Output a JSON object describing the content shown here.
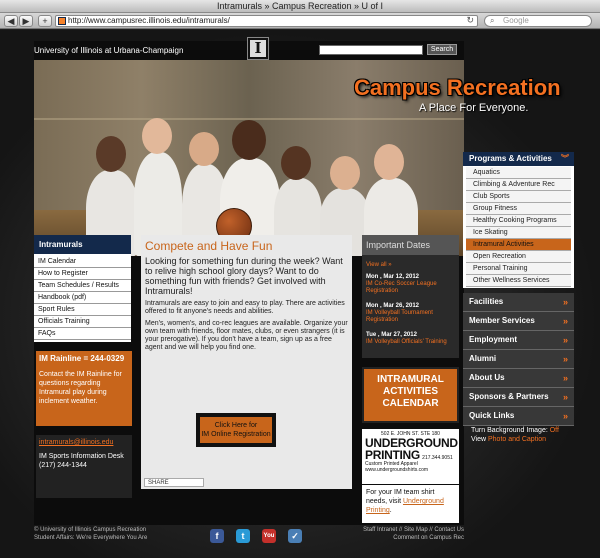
{
  "window": {
    "title": "Intramurals » Campus Recreation » U of I"
  },
  "toolbar": {
    "back": "◀",
    "forward": "▶",
    "add": "+",
    "url": "http://www.campusrec.illinois.edu/intramurals/",
    "reload": "↻",
    "search_placeholder": "Google",
    "search_icon": "search-icon"
  },
  "header": {
    "university": "University of Illinois at Urbana-Champaign",
    "logo_letter": "I",
    "search_button": "Search",
    "brand": "Campus Recreation",
    "tagline": "A Place For Everyone."
  },
  "right_nav": {
    "section": "Programs & Activities",
    "sub_items": [
      "Aquatics",
      "Climbing & Adventure Rec",
      "Club Sports",
      "Group Fitness",
      "Healthy Cooking Programs",
      "Ice Skating",
      "Intramural Activities",
      "Open Recreation",
      "Personal Training",
      "Other Wellness Services"
    ],
    "active_sub": "Intramural Activities",
    "main_items": [
      "Facilities",
      "Member Services",
      "Employment",
      "Alumni",
      "About Us",
      "Sponsors & Partners",
      "Quick Links"
    ],
    "chevron": "»",
    "bg_label": "Turn Background Image:",
    "bg_off": "Off",
    "bg_view": "View",
    "bg_photo": "Photo and Caption"
  },
  "left_nav": {
    "title": "Intramurals",
    "items": [
      "IM Calendar",
      "How to Register",
      "Team Schedules / Results",
      "Handbook (pdf)",
      "Sport Rules",
      "Officials Training",
      "FAQs"
    ]
  },
  "rainline": {
    "title": "IM Rainline = 244-0329",
    "body": "Contact the IM Rainline for questions regarding Intramural play during inclement weather."
  },
  "contact": {
    "email": "intramurals@illinois.edu",
    "desk": "IM Sports Information Desk",
    "phone": "(217) 244-1344"
  },
  "main": {
    "heading": "Compete and Have Fun",
    "lead": "Looking for something fun during the week? Want to relive high school glory days? Want to do something fun with friends? Get involved with Intramurals!",
    "p1": "Intramurals are easy to join and easy to play. There are activities offered to fit anyone's needs and abilities.",
    "p2": "Men's, women's, and co-rec leagues are available. Organize your own team with friends, floor mates, clubs, or even strangers (it is your prerogative). If you don't have a team, sign up as a free agent and we will help you find one.",
    "cta_line1": "Click Here for",
    "cta_line2": "IM Online Registration",
    "share": "SHARE"
  },
  "important_dates": {
    "title": "Important Dates",
    "view_all": "View all »",
    "events": [
      {
        "date": "Mon , Mar 12, 2012",
        "name": "IM Co-Rec Soccer League Registration"
      },
      {
        "date": "Mon , Mar 26, 2012",
        "name": "IM Volleyball Tournament Registration"
      },
      {
        "date": "Tue , Mar 27, 2012",
        "name": "IM Volleyball Officials' Training"
      }
    ]
  },
  "calendar": {
    "line1": "INTRAMURAL",
    "line2": "ACTIVITIES",
    "line3": "CALENDAR"
  },
  "ad": {
    "address": "502 E. JOHN ST. STE 180",
    "line1": "UNDERGROUND",
    "line2": "PRINTING",
    "sub": "Custom Printed Apparel",
    "phone": "217.344.9051",
    "url": "www.undergroundshirts.com"
  },
  "ad_text": {
    "before": "For your IM team shirt needs, visit ",
    "link": "Underground Printing",
    "after": "."
  },
  "footer": {
    "left1": "© University of Illinois Campus Recreation",
    "left2": "Student Affairs: We're Everywhere You Are",
    "right1": "Staff Intranet // Site Map // Contact Us",
    "right2": "Comment on Campus Rec",
    "social": [
      "f",
      "t",
      "You",
      "✓"
    ]
  },
  "colors": {
    "orange": "#f37021",
    "dark_orange": "#c8651b",
    "navy": "#13294b"
  }
}
